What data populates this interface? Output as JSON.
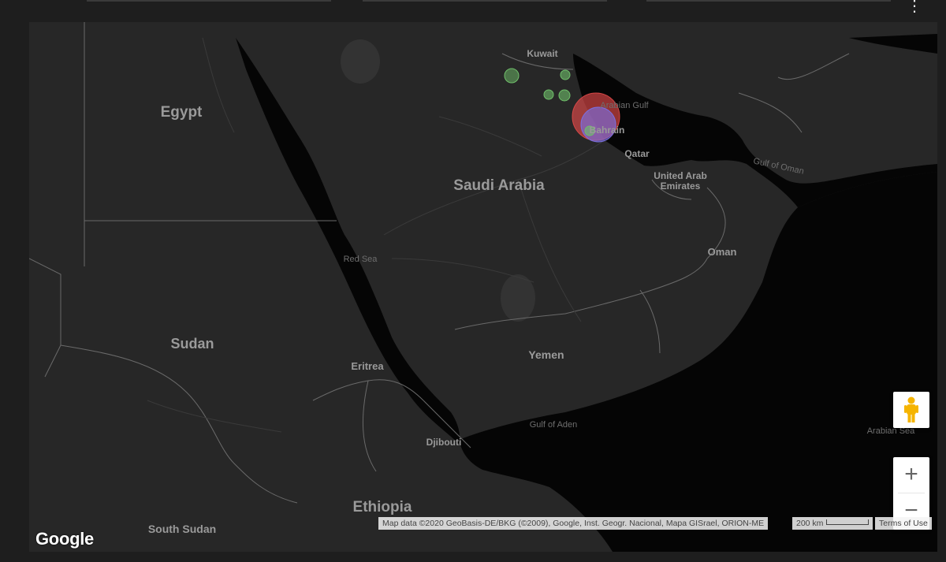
{
  "map": {
    "countries": {
      "egypt": "Egypt",
      "saudi_arabia": "Saudi Arabia",
      "kuwait": "Kuwait",
      "bahrain": "Bahrain",
      "qatar": "Qatar",
      "uae_line1": "United Arab",
      "uae_line2": "Emirates",
      "oman": "Oman",
      "yemen": "Yemen",
      "sudan": "Sudan",
      "eritrea": "Eritrea",
      "djibouti": "Djibouti",
      "ethiopia": "Ethiopia",
      "south_sudan": "South Sudan"
    },
    "water": {
      "red_sea": "Red Sea",
      "arabian_gulf": "Arabian Gulf",
      "gulf_of_oman": "Gulf of Oman",
      "gulf_of_aden": "Gulf of Aden",
      "arabian_sea": "Arabian Sea"
    },
    "markers": [
      {
        "color": "#e24a4a",
        "kind": "large-red"
      },
      {
        "color": "#7b6fe0",
        "kind": "purple"
      },
      {
        "color": "#6fbf6a",
        "kind": "green"
      },
      {
        "color": "#6fbf6a",
        "kind": "green"
      },
      {
        "color": "#6fbf6a",
        "kind": "green"
      },
      {
        "color": "#6fbf6a",
        "kind": "green"
      },
      {
        "color": "#6fbf6a",
        "kind": "green"
      }
    ]
  },
  "controls": {
    "logo": "Google",
    "zoom_in": "+",
    "zoom_out": "−",
    "menu_icon": "⋮"
  },
  "footer": {
    "attribution": "Map data ©2020 GeoBasis-DE/BKG (©2009), Google, Inst. Geogr. Nacional, Mapa GISrael, ORION-ME",
    "scale": "200 km",
    "terms": "Terms of Use"
  }
}
